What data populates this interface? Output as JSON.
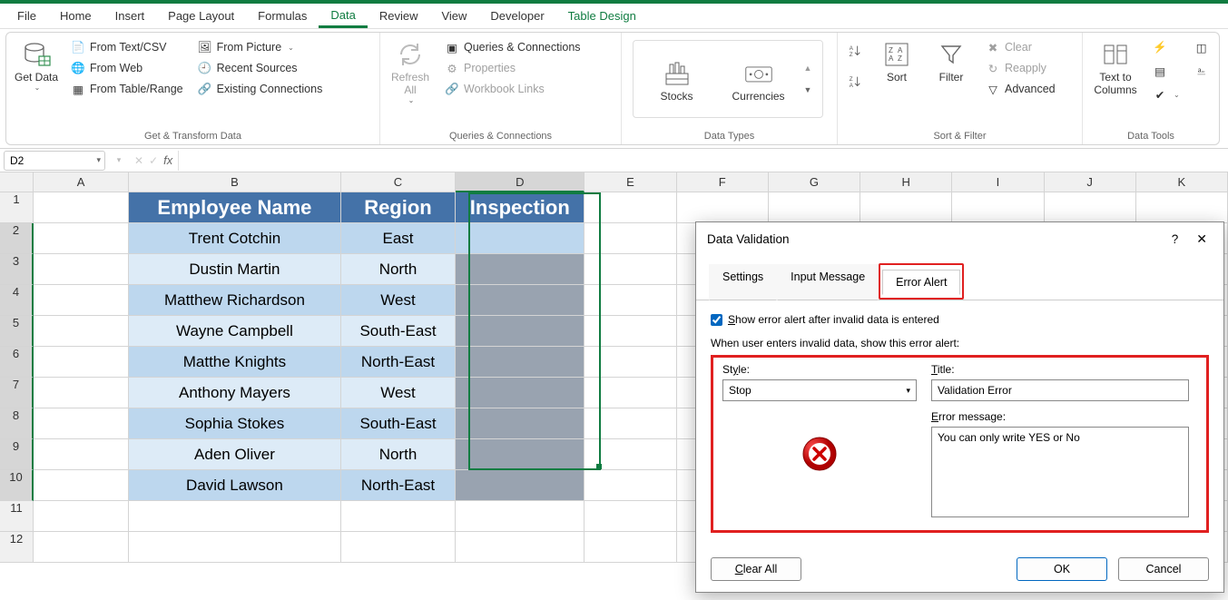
{
  "menu": {
    "file": "File",
    "home": "Home",
    "insert": "Insert",
    "page_layout": "Page Layout",
    "formulas": "Formulas",
    "data": "Data",
    "review": "Review",
    "view": "View",
    "developer": "Developer",
    "table_design": "Table Design"
  },
  "ribbon": {
    "get_data": "Get Data",
    "from_text": "From Text/CSV",
    "from_web": "From Web",
    "from_table": "From Table/Range",
    "from_picture": "From Picture",
    "recent": "Recent Sources",
    "existing": "Existing Connections",
    "grp_transform": "Get & Transform Data",
    "refresh": "Refresh All",
    "queries": "Queries & Connections",
    "properties": "Properties",
    "wb_links": "Workbook Links",
    "grp_qc": "Queries & Connections",
    "stocks": "Stocks",
    "currencies": "Currencies",
    "grp_dt": "Data Types",
    "sort": "Sort",
    "filter": "Filter",
    "clear": "Clear",
    "reapply": "Reapply",
    "advanced": "Advanced",
    "grp_sf": "Sort & Filter",
    "text_cols": "Text to Columns",
    "grp_tools": "Data Tools"
  },
  "name_box": "D2",
  "columns": [
    "A",
    "B",
    "C",
    "D",
    "E",
    "F",
    "G",
    "H",
    "I",
    "J",
    "K"
  ],
  "headers": {
    "b": "Employee Name",
    "c": "Region",
    "d": "Inspection"
  },
  "rows": [
    {
      "n": "1"
    },
    {
      "n": "2",
      "b": "Trent Cotchin",
      "c": "East"
    },
    {
      "n": "3",
      "b": "Dustin Martin",
      "c": "North"
    },
    {
      "n": "4",
      "b": "Matthew Richardson",
      "c": "West"
    },
    {
      "n": "5",
      "b": "Wayne Campbell",
      "c": "South-East"
    },
    {
      "n": "6",
      "b": "Matthe Knights",
      "c": "North-East"
    },
    {
      "n": "7",
      "b": "Anthony Mayers",
      "c": "West"
    },
    {
      "n": "8",
      "b": "Sophia Stokes",
      "c": "South-East"
    },
    {
      "n": "9",
      "b": "Aden Oliver",
      "c": "North"
    },
    {
      "n": "10",
      "b": "David Lawson",
      "c": "North-East"
    },
    {
      "n": "11"
    },
    {
      "n": "12"
    }
  ],
  "dialog": {
    "title": "Data Validation",
    "help": "?",
    "tabs": {
      "settings": "Settings",
      "input": "Input Message",
      "error": "Error Alert"
    },
    "show_label": "Show error alert after invalid data is entered",
    "when_label": "When user enters invalid data, show this error alert:",
    "style_label": "Style:",
    "style_val": "Stop",
    "title_label": "Title:",
    "title_val": "Validation Error",
    "msg_label": "Error message:",
    "msg_val": "You can only write YES or No",
    "clear": "Clear All",
    "ok": "OK",
    "cancel": "Cancel"
  }
}
